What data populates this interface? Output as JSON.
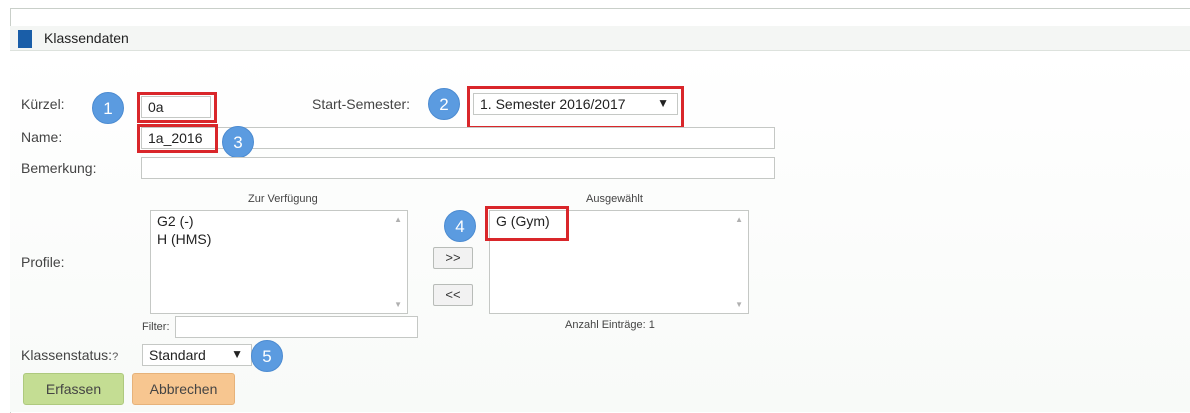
{
  "panel": {
    "title": "Klassendaten"
  },
  "form": {
    "kuerzel_label": "Kürzel:",
    "kuerzel_value": "0a",
    "start_semester_label": "Start-Semester:",
    "start_semester_value": "1. Semester 2016/2017",
    "name_label": "Name:",
    "name_value": "1a_2016",
    "bemerkung_label": "Bemerkung:",
    "bemerkung_value": "",
    "profile_label": "Profile:",
    "klassenstatus_label": "Klassenstatus:",
    "klassenstatus_help": "?",
    "klassenstatus_value": "Standard"
  },
  "profiles": {
    "available_title": "Zur Verfügung",
    "selected_title": "Ausgewählt",
    "available": [
      "G2 (-)",
      "H (HMS)"
    ],
    "selected": [
      "G (Gym)"
    ],
    "filter_label": "Filter:",
    "filter_value": "",
    "add_button": ">>",
    "remove_button": "<<",
    "count_label": "Anzahl Einträge: 1"
  },
  "buttons": {
    "submit": "Erfassen",
    "cancel": "Abbrechen"
  },
  "annotations": [
    "1",
    "2",
    "3",
    "4",
    "5"
  ],
  "colors": {
    "accent": "#1a5ea8",
    "highlight": "#d9262a",
    "badge": "#5b9be0",
    "submit": "#c4dd93",
    "cancel": "#f7c690"
  },
  "icons": {
    "dropdown": "caret-down-icon",
    "scroll_up": "scroll-up-icon",
    "scroll_down": "scroll-down-icon"
  }
}
